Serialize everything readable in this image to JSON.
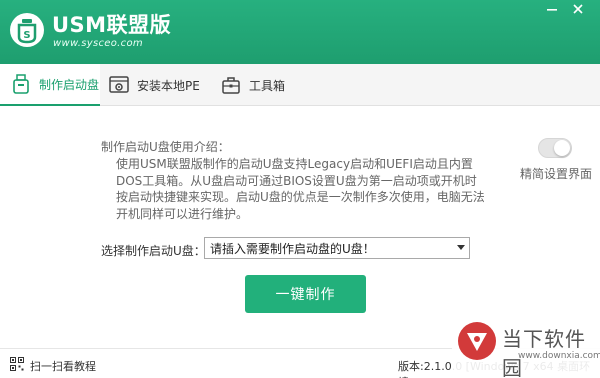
{
  "app": {
    "title": "USM联盟版",
    "url": "www.sysceo.com",
    "brand_color": "#1e9e6f"
  },
  "window_controls": {
    "minimize_icon": "minimize-icon",
    "close_icon": "close-icon"
  },
  "tabs": [
    {
      "label": "制作启动盘",
      "icon": "usb-drive-icon",
      "active": true
    },
    {
      "label": "安装本地PE",
      "icon": "install-gear-icon",
      "active": false
    },
    {
      "label": "工具箱",
      "icon": "toolbox-icon",
      "active": false
    }
  ],
  "intro": {
    "title": "制作启动U盘使用介绍：",
    "body": "使用USM联盟版制作的启动U盘支持Legacy启动和UEFI启动且内置DOS工具箱。从U盘启动可通过BIOS设置U盘为第一启动项或开机时按启动快捷键来实现。启动U盘的优点是一次制作多次使用，电脑无法开机同样可以进行维护。"
  },
  "simple_mode": {
    "label": "精简设置界面",
    "enabled": false
  },
  "select_drive": {
    "label": "选择制作启动U盘：",
    "value": "请插入需要制作启动盘的U盘！"
  },
  "action": {
    "make_label": "一键制作"
  },
  "status": {
    "scan_label": "扫一扫看教程",
    "version": "版本:2.1.0.0 [Windows 7 x64 桌面环境]"
  },
  "watermark": {
    "name": "当下软件园",
    "url": "www.downxia.com"
  }
}
